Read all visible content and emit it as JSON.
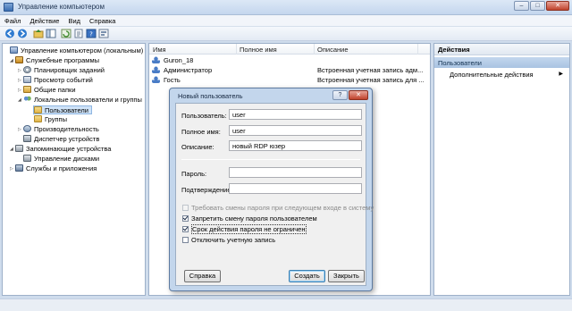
{
  "window": {
    "title": "Управление компьютером",
    "controls": [
      "–",
      "□",
      "✕"
    ]
  },
  "menu": [
    "Файл",
    "Действие",
    "Вид",
    "Справка"
  ],
  "tree": [
    {
      "label": "Управление компьютером (локальным)",
      "level": 0,
      "icon": "computer-management-icon",
      "expander": ""
    },
    {
      "label": "Служебные программы",
      "level": 1,
      "icon": "tools-icon",
      "expander": "◢"
    },
    {
      "label": "Планировщик заданий",
      "level": 2,
      "icon": "clock-icon",
      "expander": "▷"
    },
    {
      "label": "Просмотр событий",
      "level": 2,
      "icon": "event-viewer-icon",
      "expander": "▷"
    },
    {
      "label": "Общие папки",
      "level": 2,
      "icon": "shared-folder-icon",
      "expander": "▷"
    },
    {
      "label": "Локальные пользователи и группы",
      "level": 2,
      "icon": "users-icon",
      "expander": "◢"
    },
    {
      "label": "Пользователи",
      "level": 3,
      "icon": "folder-icon",
      "expander": "",
      "selected": true
    },
    {
      "label": "Группы",
      "level": 3,
      "icon": "folder-icon",
      "expander": ""
    },
    {
      "label": "Производительность",
      "level": 2,
      "icon": "performance-icon",
      "expander": "▷"
    },
    {
      "label": "Диспетчер устройств",
      "level": 2,
      "icon": "device-manager-icon",
      "expander": ""
    },
    {
      "label": "Запоминающие устройства",
      "level": 1,
      "icon": "storage-icon",
      "expander": "◢"
    },
    {
      "label": "Управление дисками",
      "level": 2,
      "icon": "disk-icon",
      "expander": ""
    },
    {
      "label": "Службы и приложения",
      "level": 1,
      "icon": "services-icon",
      "expander": "▷"
    }
  ],
  "list": {
    "columns": [
      "Имя",
      "Полное имя",
      "Описание"
    ],
    "rows": [
      {
        "name": "Guron_18",
        "fullname": "",
        "description": ""
      },
      {
        "name": "Администратор",
        "fullname": "",
        "description": "Встроенная учетная запись адм..."
      },
      {
        "name": "Гость",
        "fullname": "",
        "description": "Встроенная учетная запись для ..."
      }
    ]
  },
  "actions": {
    "header": "Действия",
    "section": "Пользователи",
    "item": "Дополнительные действия",
    "arrow": "▶"
  },
  "dialog": {
    "title": "Новый пользователь",
    "controls": [
      "?",
      "✕"
    ],
    "fields": {
      "username_label": "Пользователь:",
      "username_value": "user",
      "fullname_label": "Полное имя:",
      "fullname_value": "user",
      "description_label": "Описание:",
      "description_value": "новый RDP юзер",
      "password_label": "Пароль:",
      "password_value": "",
      "confirm_label": "Подтверждение:",
      "confirm_value": ""
    },
    "checkboxes": [
      {
        "label": "Требовать смены пароля при следующем входе в систему",
        "checked": false,
        "disabled": true
      },
      {
        "label": "Запретить смену пароля пользователем",
        "checked": true,
        "disabled": false
      },
      {
        "label": "Срок действия пароля не ограничен",
        "checked": true,
        "disabled": false,
        "focused": true
      },
      {
        "label": "Отключить учетную запись",
        "checked": false,
        "disabled": false
      }
    ],
    "buttons": {
      "help": "Справка",
      "create": "Создать",
      "close": "Закрыть"
    }
  }
}
